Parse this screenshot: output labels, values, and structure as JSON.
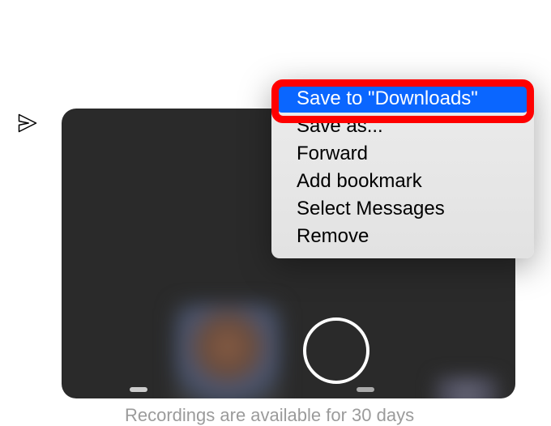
{
  "send_icon_name": "send-icon",
  "context_menu": {
    "items": [
      {
        "label": "Save to \"Downloads\"",
        "selected": true
      },
      {
        "label": "Save as...",
        "selected": false
      },
      {
        "label": "Forward",
        "selected": false
      },
      {
        "label": "Add bookmark",
        "selected": false
      },
      {
        "label": "Select Messages",
        "selected": false
      },
      {
        "label": "Remove",
        "selected": false
      }
    ]
  },
  "footer": {
    "text": "Recordings are available for 30 days"
  },
  "colors": {
    "highlight_ring": "#ff0000",
    "selection_bg": "#0a66ff"
  }
}
